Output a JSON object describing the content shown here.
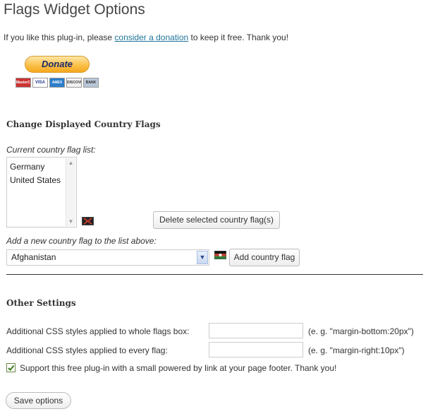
{
  "page": {
    "title": "Flags Widget Options",
    "intro": {
      "before": "If you like this plug-in, please ",
      "link": "consider a donation",
      "after": " to keep it free. Thank you!"
    },
    "donate_label": "Donate",
    "payment_cards": [
      "MasterCard",
      "VISA",
      "AMEX",
      "DISCOVER",
      "BANK"
    ]
  },
  "flags_section": {
    "heading": "Change Displayed Country Flags",
    "current_list_label": "Current country flag list:",
    "current_list": [
      "Germany",
      "United States"
    ],
    "delete_label": "Delete selected country flag(s)",
    "add_label": "Add a new country flag to the list above:",
    "selected_country": "Afghanistan",
    "add_button": "Add country flag"
  },
  "other_section": {
    "heading": "Other Settings",
    "box_css_label": "Additional CSS styles applied to whole flags box:",
    "box_css_value": "",
    "box_css_hint": "(e. g. \"margin-bottom:20px\")",
    "flag_css_label": "Additional CSS styles applied to every flag:",
    "flag_css_value": "",
    "flag_css_hint": "(e. g. \"margin-right:10px\")",
    "support_label": "Support this free plug-in with a small powered by link at your page footer. Thank you!",
    "support_checked": true
  },
  "save_label": "Save options",
  "colors": {
    "link": "#21759b",
    "donate_gradient_top": "#fde6a8",
    "donate_gradient_bottom": "#f5a81e",
    "checkbox_check": "#3a7a1a"
  }
}
